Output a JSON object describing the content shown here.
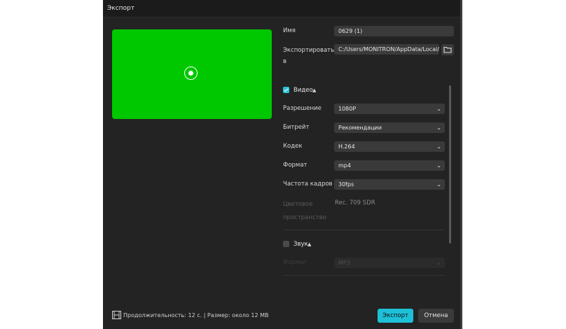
{
  "dialog": {
    "title": "Экспорт"
  },
  "fields": {
    "name_label": "Имя",
    "name_value": "0629 (1)",
    "export_to_label_1": "Экспортировать",
    "export_to_label_2": "в",
    "export_path": "C:/Users/MONITRON/AppData/Local/..."
  },
  "video": {
    "section_label": "Видео",
    "checked": true,
    "resolution_label": "Разрешение",
    "resolution_value": "1080P",
    "bitrate_label": "Битрейт",
    "bitrate_value": "Рекомендации",
    "codec_label": "Кодек",
    "codec_value": "H.264",
    "format_label": "Формат",
    "format_value": "mp4",
    "framerate_label": "Частота кадров",
    "framerate_value": "30fps",
    "colorspace_label_1": "Цветовое",
    "colorspace_label_2": "пространство",
    "colorspace_value": "Rec. 709 SDR"
  },
  "audio": {
    "section_label": "Звук",
    "checked": false,
    "format_label": "Формат",
    "format_value": "MP3"
  },
  "footer": {
    "info": "Продолжительность: 12 с. | Размер: около 12 MB",
    "export_button": "Экспорт",
    "cancel_button": "Отмена"
  },
  "colors": {
    "accent": "#1ec0d8",
    "preview": "#00c800",
    "background": "#232323"
  },
  "icons": [
    "play-icon",
    "folder-icon",
    "check-icon",
    "chevron-down-icon",
    "caret-up-icon",
    "film-icon"
  ]
}
